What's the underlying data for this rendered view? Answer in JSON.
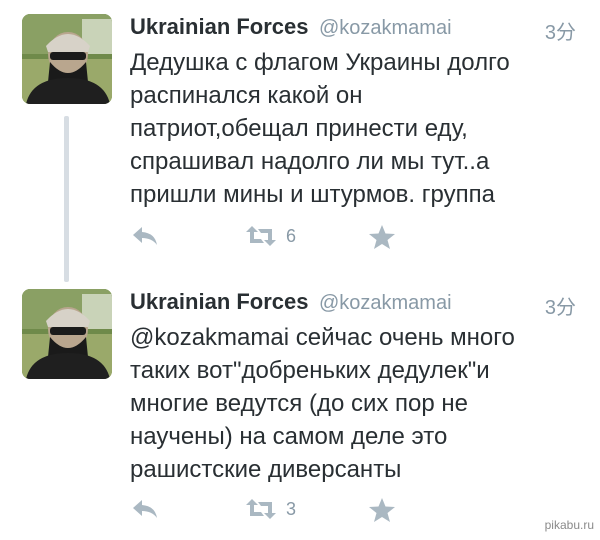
{
  "tweets": [
    {
      "name": "Ukrainian Forces",
      "handle": "@kozakmamai",
      "time": "3分",
      "text": "Дедушка с флагом Украины долго\nраспинался какой он\nпатриот,обещал принести еду,\nспрашивал надолго ли мы тут..а\nпришли мины и штурмов. группа",
      "retweets": "6",
      "icons": [
        "reply-icon",
        "retweet-icon",
        "favorite-icon"
      ]
    },
    {
      "name": "Ukrainian Forces",
      "handle": "@kozakmamai",
      "time": "3分",
      "text": "@kozakmamai сейчас очень много\nтаких вот\"добреньких дедулек\"и\nмногие ведутся (до сих пор не\nнаучены) на самом деле это\nрашистские диверсанты",
      "retweets": "3",
      "icons": [
        "reply-icon",
        "retweet-icon",
        "favorite-icon"
      ]
    }
  ],
  "colors": {
    "icon": "#aab8c2",
    "meta": "#8899a6",
    "text": "#292f33",
    "thread": "#d7dde3"
  },
  "watermark": "pikabu.ru"
}
